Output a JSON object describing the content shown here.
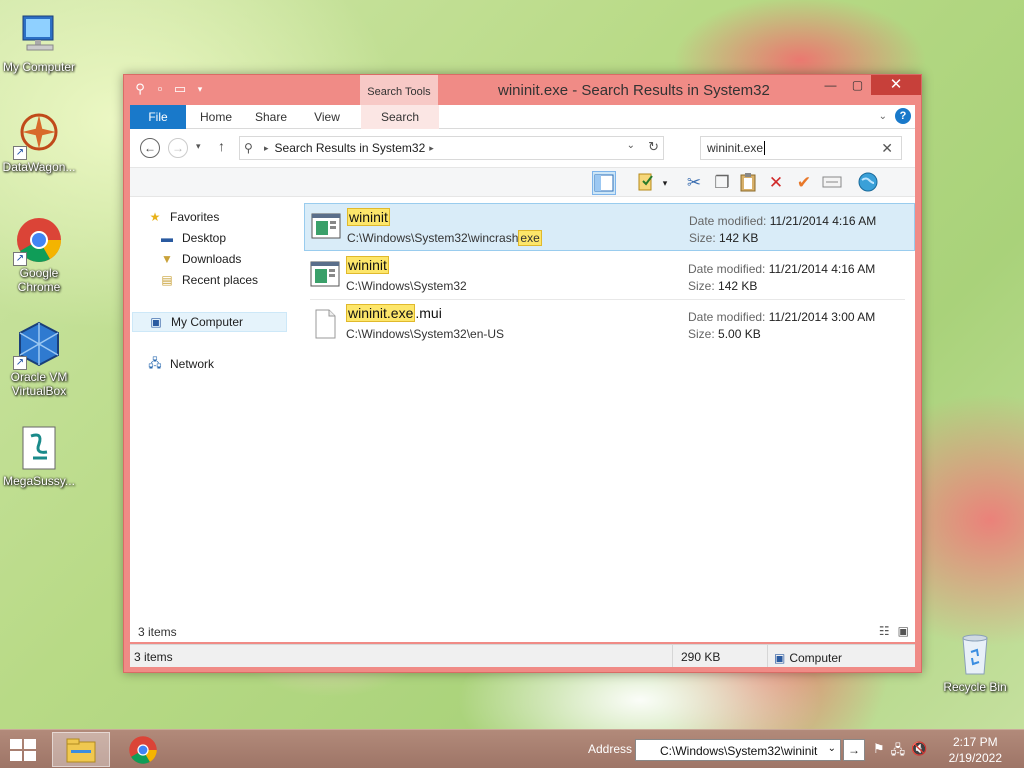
{
  "desktop": {
    "icons": [
      {
        "label": "My Computer"
      },
      {
        "label": "DataWagon..."
      },
      {
        "label": "Google Chrome"
      },
      {
        "label": "Oracle VM VirtualBox"
      },
      {
        "label": "MegaSussy..."
      },
      {
        "label": "Recycle Bin"
      }
    ]
  },
  "window": {
    "title": "wininit.exe - Search Results in System32",
    "context_tab_group": "Search Tools",
    "ribbon_tabs": [
      "File",
      "Home",
      "Share",
      "View",
      "Search"
    ],
    "address_path": "Search Results in System32",
    "search_value": "wininit.exe",
    "nav": {
      "favorites": "Favorites",
      "desktop": "Desktop",
      "downloads": "Downloads",
      "recent": "Recent places",
      "computer": "My Computer",
      "network": "Network"
    },
    "results": [
      {
        "name_hl": "wininit",
        "name_rest": "",
        "path_pre": "C:\\Windows\\System32\\wincrash",
        "path_hl": "exe",
        "date_label": "Date modified:",
        "date": "11/21/2014 4:16 AM",
        "size_label": "Size:",
        "size": "142 KB"
      },
      {
        "name_hl": "wininit",
        "name_rest": "",
        "path_pre": "C:\\Windows\\System32",
        "path_hl": "",
        "date_label": "Date modified:",
        "date": "11/21/2014 4:16 AM",
        "size_label": "Size:",
        "size": "142 KB"
      },
      {
        "name_hl": "wininit.exe",
        "name_rest": ".mui",
        "path_pre": "C:\\Windows\\System32\\en-US",
        "path_hl": "",
        "date_label": "Date modified:",
        "date": "11/21/2014 3:00 AM",
        "size_label": "Size:",
        "size": "5.00 KB"
      }
    ],
    "item_count": "3 items",
    "status": {
      "items": "3 items",
      "size": "290 KB",
      "location": "Computer"
    }
  },
  "taskbar": {
    "address_label": "Address",
    "address_value": "C:\\Windows\\System32\\wininit",
    "time": "2:17 PM",
    "date": "2/19/2022"
  },
  "colors": {
    "window_frame": "#f08b86",
    "accent_blue": "#1979ca",
    "highlight": "#fde66a"
  }
}
